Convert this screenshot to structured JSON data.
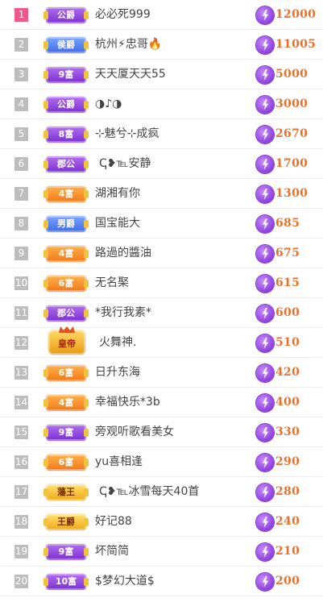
{
  "colors": {
    "amount": "#e8702a",
    "rank_default": "#bdbdbd",
    "rank_first": "#f0588a"
  },
  "rows": [
    {
      "rank": "1",
      "badge": "公爵",
      "badge_style": "purple",
      "name": "必必死999",
      "amount": "12000"
    },
    {
      "rank": "2",
      "badge": "侯爵",
      "badge_style": "blue",
      "name": "杭州⚡忠哥🔥",
      "amount": "11005"
    },
    {
      "rank": "3",
      "badge": "9富",
      "badge_style": "purple",
      "name": "天天厦天天55",
      "amount": "5000"
    },
    {
      "rank": "4",
      "badge": "公爵",
      "badge_style": "purple",
      "name": "◑♪◑",
      "amount": "3000"
    },
    {
      "rank": "5",
      "badge": "8富",
      "badge_style": "purple",
      "name": "⊹魅兮⊹成疯",
      "amount": "2670"
    },
    {
      "rank": "6",
      "badge": "郡公",
      "badge_style": "purple",
      "name": "ↅ❥℡安静",
      "amount": "1700"
    },
    {
      "rank": "7",
      "badge": "4富",
      "badge_style": "orange",
      "name": "湖湘有你",
      "amount": "1300"
    },
    {
      "rank": "8",
      "badge": "男爵",
      "badge_style": "blue",
      "name": "国宝能大",
      "amount": "685"
    },
    {
      "rank": "9",
      "badge": "4富",
      "badge_style": "orange",
      "name": "路過的醬油",
      "amount": "675"
    },
    {
      "rank": "10",
      "badge": "6富",
      "badge_style": "orange",
      "name": "无名棸",
      "amount": "615"
    },
    {
      "rank": "11",
      "badge": "郡公",
      "badge_style": "purple",
      "name": "*我行我素*",
      "amount": "600"
    },
    {
      "rank": "12",
      "badge": "皇帝",
      "badge_style": "emperor",
      "name": "火舞神.",
      "amount": "510"
    },
    {
      "rank": "13",
      "badge": "6富",
      "badge_style": "orange",
      "name": "日升东海",
      "amount": "420"
    },
    {
      "rank": "14",
      "badge": "4富",
      "badge_style": "orange",
      "name": "幸福快乐*3b",
      "amount": "400"
    },
    {
      "rank": "15",
      "badge": "9富",
      "badge_style": "purple",
      "name": "旁观听歌看美女",
      "amount": "330"
    },
    {
      "rank": "16",
      "badge": "6富",
      "badge_style": "orange",
      "name": "yu喜相逢",
      "amount": "290"
    },
    {
      "rank": "17",
      "badge": "藩王",
      "badge_style": "gold",
      "name": "ↅ❥℡冰雪每天40首",
      "amount": "280"
    },
    {
      "rank": "18",
      "badge": "王爵",
      "badge_style": "gold",
      "name": "好记88",
      "amount": "240"
    },
    {
      "rank": "19",
      "badge": "9富",
      "badge_style": "purple",
      "name": "坏简简",
      "amount": "210"
    },
    {
      "rank": "20",
      "badge": "10富",
      "badge_style": "purple",
      "name": "$梦幻大道$",
      "amount": "200"
    }
  ]
}
